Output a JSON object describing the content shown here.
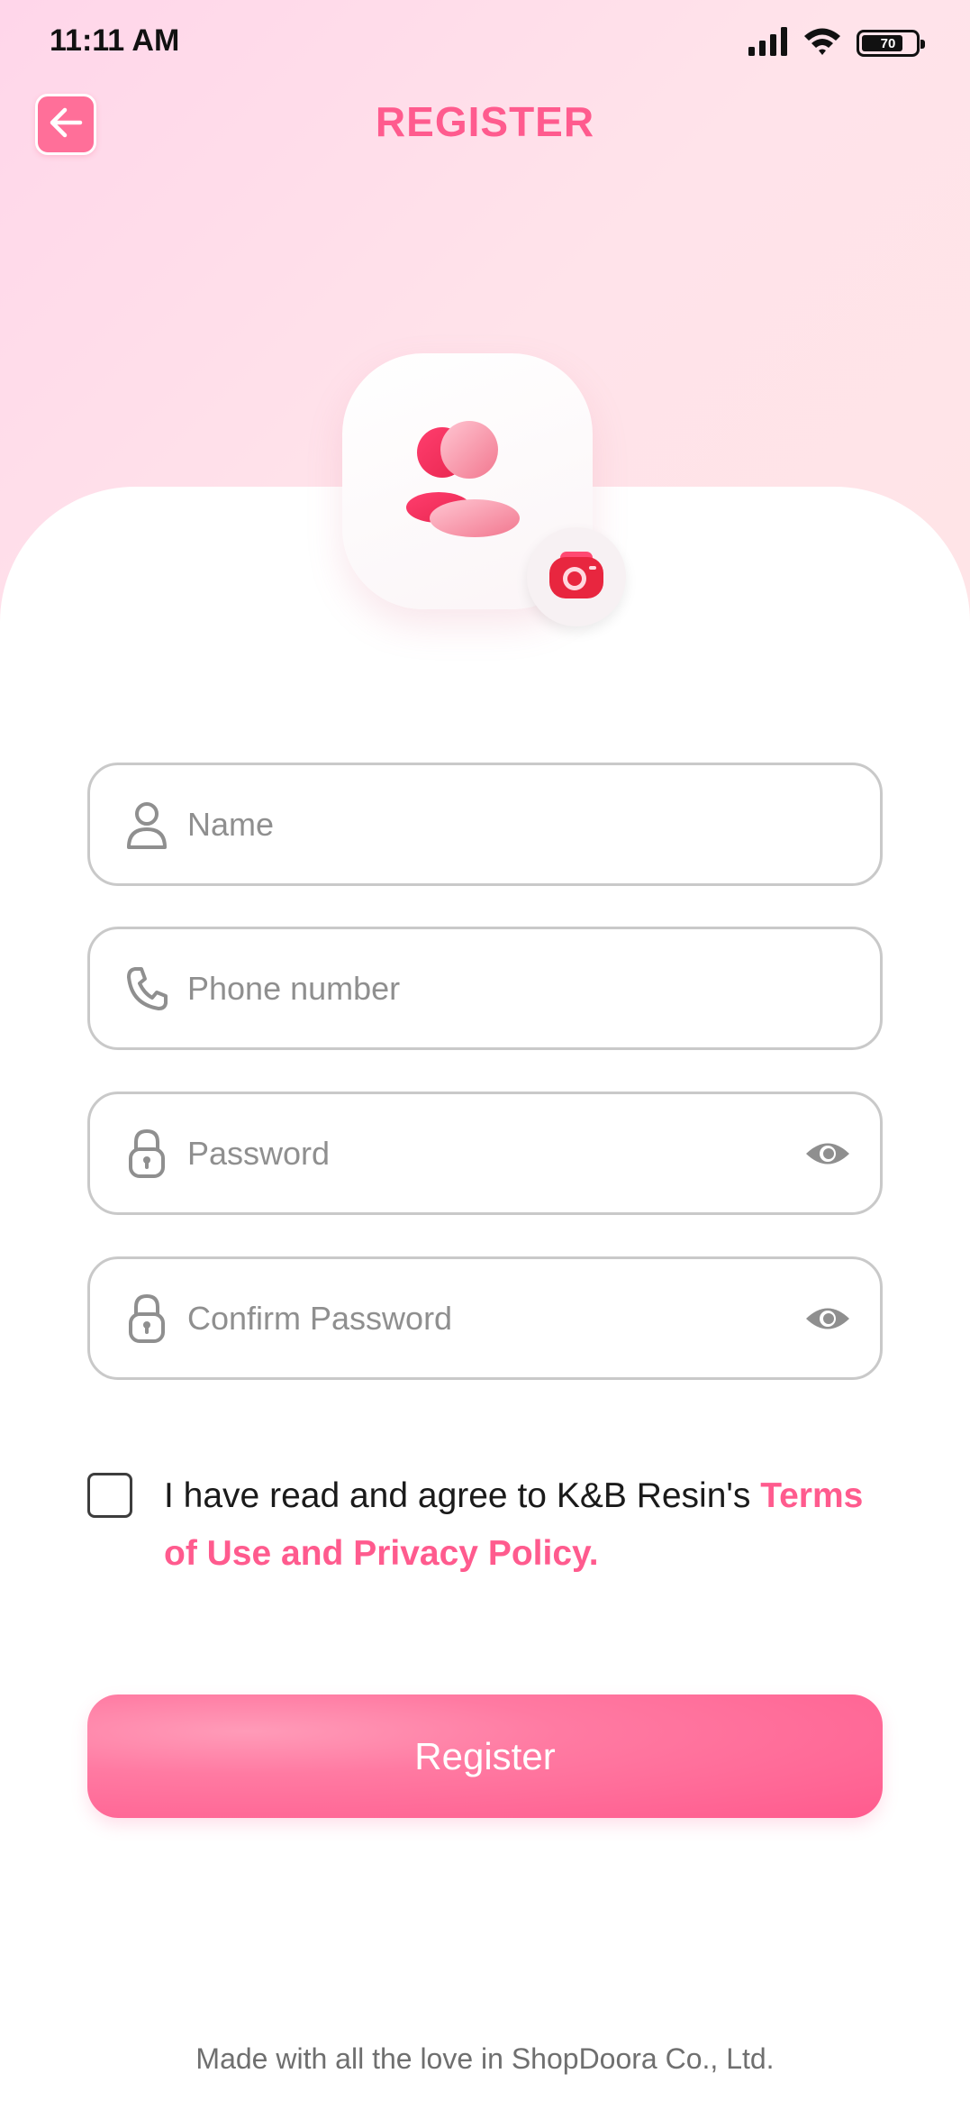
{
  "status_bar": {
    "time": "11:11 AM",
    "battery": "70",
    "battery_level": 0.7
  },
  "header": {
    "title": "REGISTER",
    "back_icon": "arrow-left-icon"
  },
  "avatar": {
    "icon": "user-group-icon",
    "camera_icon": "camera-icon"
  },
  "form": {
    "name": {
      "placeholder": "Name",
      "value": "",
      "icon": "user-icon"
    },
    "phone": {
      "placeholder": "Phone number",
      "value": "",
      "icon": "phone-icon"
    },
    "password": {
      "placeholder": "Password",
      "value": "",
      "icon": "lock-icon",
      "toggle_icon": "eye-icon"
    },
    "confirm_password": {
      "placeholder": "Confirm Password",
      "value": "",
      "icon": "lock-icon",
      "toggle_icon": "eye-icon"
    }
  },
  "terms": {
    "checked": false,
    "text": "I have read and agree to K&B Resin's ",
    "link_text": "Terms of Use and Privacy Policy."
  },
  "register_button": {
    "label": "Register"
  },
  "footer": {
    "text": "Made with all the love in ShopDoora Co., Ltd."
  },
  "colors": {
    "accent": "#ff5b8e",
    "field_border": "#c9c9c9",
    "placeholder": "#8f8f8f"
  }
}
